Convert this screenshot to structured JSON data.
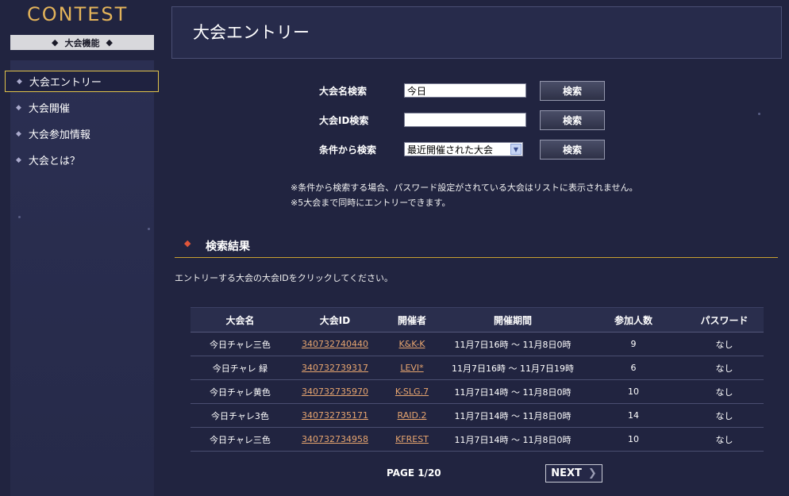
{
  "sidebar": {
    "logo": "CONTEST",
    "section_title": "大会機能",
    "items": [
      {
        "label": "大会エントリー",
        "active": true
      },
      {
        "label": "大会開催",
        "active": false
      },
      {
        "label": "大会参加情報",
        "active": false
      },
      {
        "label": "大会とは？",
        "active": false
      }
    ]
  },
  "header": {
    "title": "大会エントリー"
  },
  "search": {
    "name_label": "大会名検索",
    "name_value": "今日",
    "id_label": "大会ID検索",
    "id_value": "",
    "condition_label": "条件から検索",
    "condition_selected": "最近開催された大会",
    "button_label": "検索"
  },
  "notes": [
    "※条件から検索する場合、パスワード設定がされている大会はリストに表示されません。",
    "※5大会まで同時にエントリーできます。"
  ],
  "results": {
    "title": "検索結果",
    "instruction": "エントリーする大会の大会IDをクリックしてください。",
    "columns": [
      "大会名",
      "大会ID",
      "開催者",
      "開催期間",
      "参加人数",
      "パスワード"
    ],
    "rows": [
      {
        "name": "今日チャレ三色",
        "id": "340732740440",
        "host": "K&K-K",
        "period": "11月7日16時 ～ 11月8日0時",
        "participants": "9",
        "password": "なし"
      },
      {
        "name": "今日チャレ 緑",
        "id": "340732739317",
        "host": "LEVI*",
        "period": "11月7日16時 ～ 11月7日19時",
        "participants": "6",
        "password": "なし"
      },
      {
        "name": "今日チャレ黄色",
        "id": "340732735970",
        "host": "K-SLG.7",
        "period": "11月7日14時 ～ 11月8日0時",
        "participants": "10",
        "password": "なし"
      },
      {
        "name": "今日チャレ3色",
        "id": "340732735171",
        "host": "RAID.2",
        "period": "11月7日14時 ～ 11月8日0時",
        "participants": "14",
        "password": "なし"
      },
      {
        "name": "今日チャレ三色",
        "id": "340732734958",
        "host": "KFREST",
        "period": "11月7日14時 ～ 11月8日0時",
        "participants": "10",
        "password": "なし"
      }
    ]
  },
  "pagination": {
    "page_text": "PAGE 1/20",
    "next_label": "NEXT"
  },
  "colors": {
    "background": "#212440",
    "logo": "#e3b35a",
    "active_border": "#e1c34a",
    "link": "#e7a56f",
    "accent_diamond": "#e0553a"
  }
}
